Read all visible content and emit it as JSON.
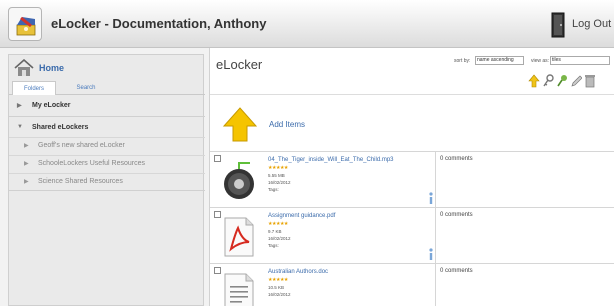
{
  "header": {
    "title": "eLocker - Documentation, Anthony",
    "logout_label": "Log Out"
  },
  "sidebar": {
    "home_label": "Home",
    "tabs": [
      "Folders",
      "Search"
    ],
    "my_elocker": "My eLocker",
    "shared_elockers": "Shared eLockers",
    "shared_items": [
      "Geoff's new shared eLocker",
      "SchooleLockers Useful Resources",
      "Science Shared Resources"
    ]
  },
  "main": {
    "title": "eLocker",
    "sort_label": "sort by:",
    "sort_value": "name ascending",
    "view_label": "view as:",
    "view_value": "tiles",
    "add_items_label": "Add Items",
    "files": [
      {
        "name": "04_The_Tiger_inside_Will_Eat_The_Child.mp3",
        "stars": "★★★★★",
        "size": "5.55 MB",
        "date": "16/02/2012",
        "tags": "Tags:",
        "comments": "0 comments",
        "type": "audio"
      },
      {
        "name": "Assignment guidance.pdf",
        "stars": "★★★★★",
        "size": "9.7 KB",
        "date": "16/02/2012",
        "tags": "Tags:",
        "comments": "0 comments",
        "type": "pdf"
      },
      {
        "name": "Australian Authors.doc",
        "stars": "★★★★★",
        "size": "10.5 KB",
        "date": "16/02/2012",
        "tags": "",
        "comments": "0 comments",
        "type": "document"
      }
    ]
  },
  "colors": {
    "link": "#3b6bab",
    "star": "#e8a200",
    "add_arrow": "#f5c400",
    "pdf": "#d62a1f"
  }
}
